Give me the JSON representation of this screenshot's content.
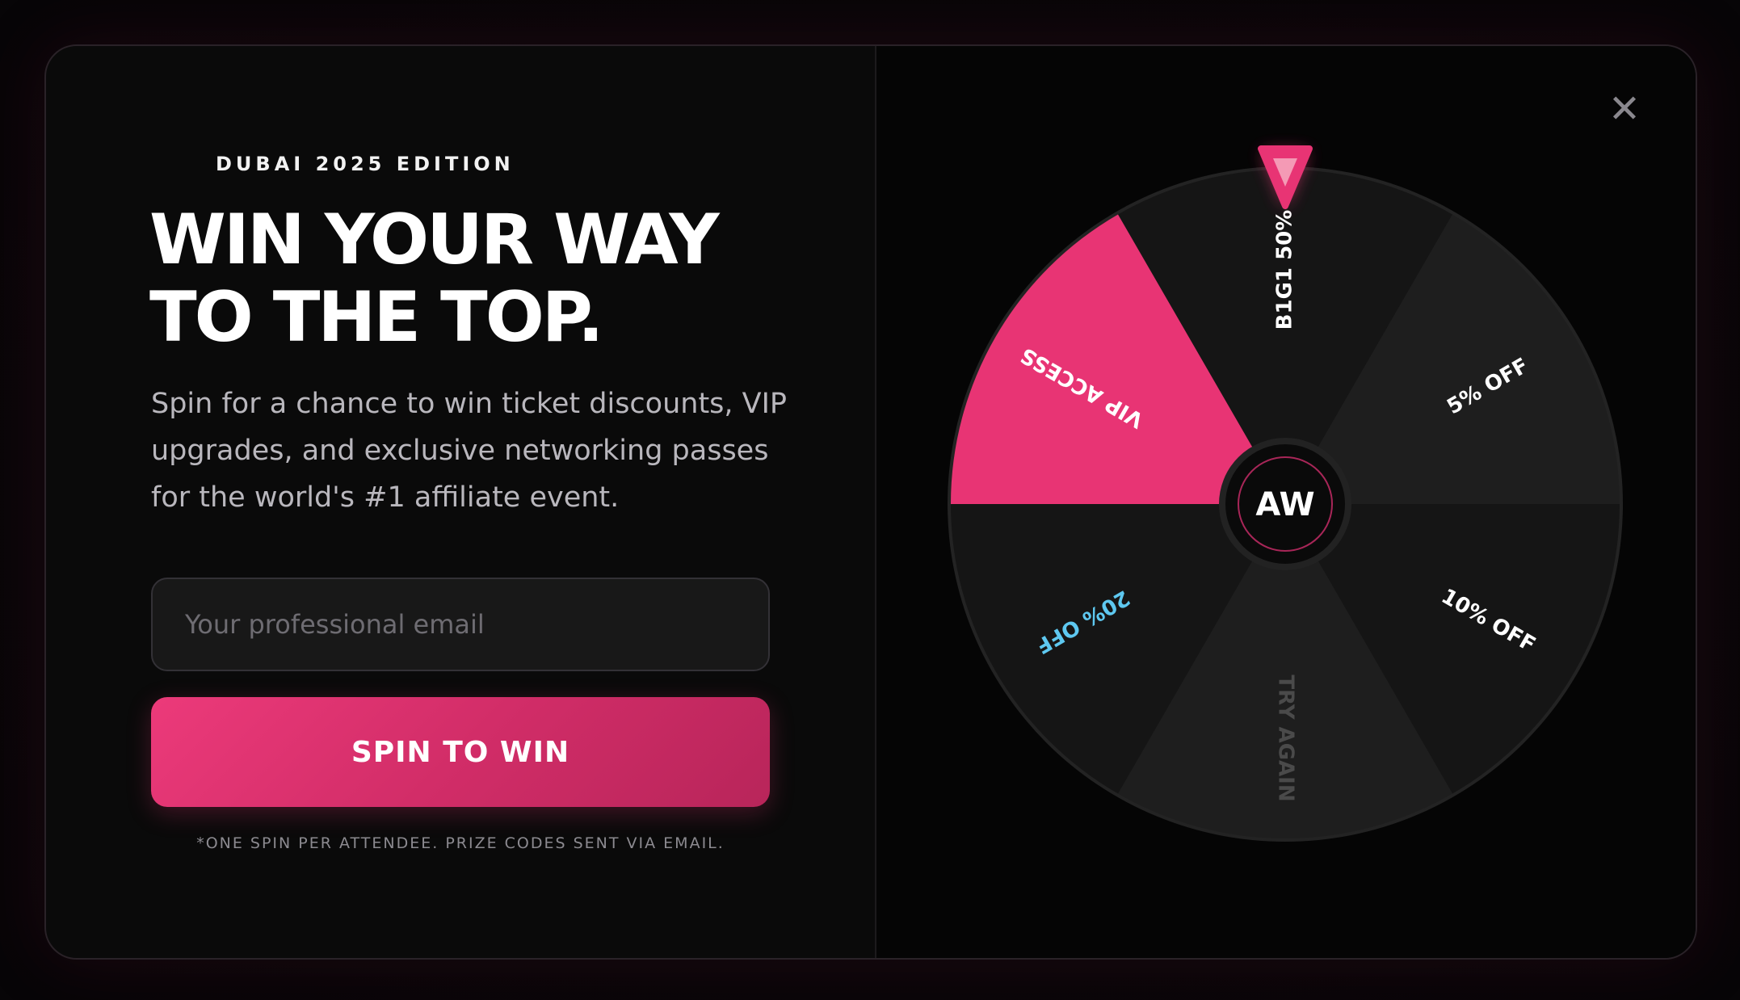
{
  "promo": {
    "eyebrow": "DUBAI 2025 EDITION",
    "headline_line1": "WIN YOUR WAY",
    "headline_line2": "TO THE TOP.",
    "subcopy": "Spin for a chance to win ticket discounts, VIP upgrades, and exclusive networking passes for the world's #1 affiliate event."
  },
  "form": {
    "email_placeholder": "Your professional email",
    "email_value": "",
    "submit_label": "SPIN TO WIN",
    "disclaimer": "*ONE SPIN PER ATTENDEE. PRIZE CODES SENT VIA EMAIL."
  },
  "close": {
    "icon": "close-icon",
    "glyph": "✕"
  },
  "wheel": {
    "hub_label": "AW",
    "segments": [
      {
        "label": "B1G1 50%",
        "fill": "#151515",
        "text_color": "#ffffff"
      },
      {
        "label": "5% OFF",
        "fill": "#1e1e1e",
        "text_color": "#ffffff"
      },
      {
        "label": "10% OFF",
        "fill": "#151515",
        "text_color": "#ffffff"
      },
      {
        "label": "TRY AGAIN",
        "fill": "#1e1e1e",
        "text_color": "#4a4a4a"
      },
      {
        "label": "20% OFF",
        "fill": "#151515",
        "text_color": "#5ec8f0"
      },
      {
        "label": "VIP ACCESS",
        "fill": "#e83474",
        "text_color": "#ffffff"
      }
    ],
    "pointer_icon": "triangle-pointer-icon"
  },
  "colors": {
    "accent": "#e83474",
    "panel": "#0a0a0a",
    "text_muted": "#b9b7bd"
  }
}
